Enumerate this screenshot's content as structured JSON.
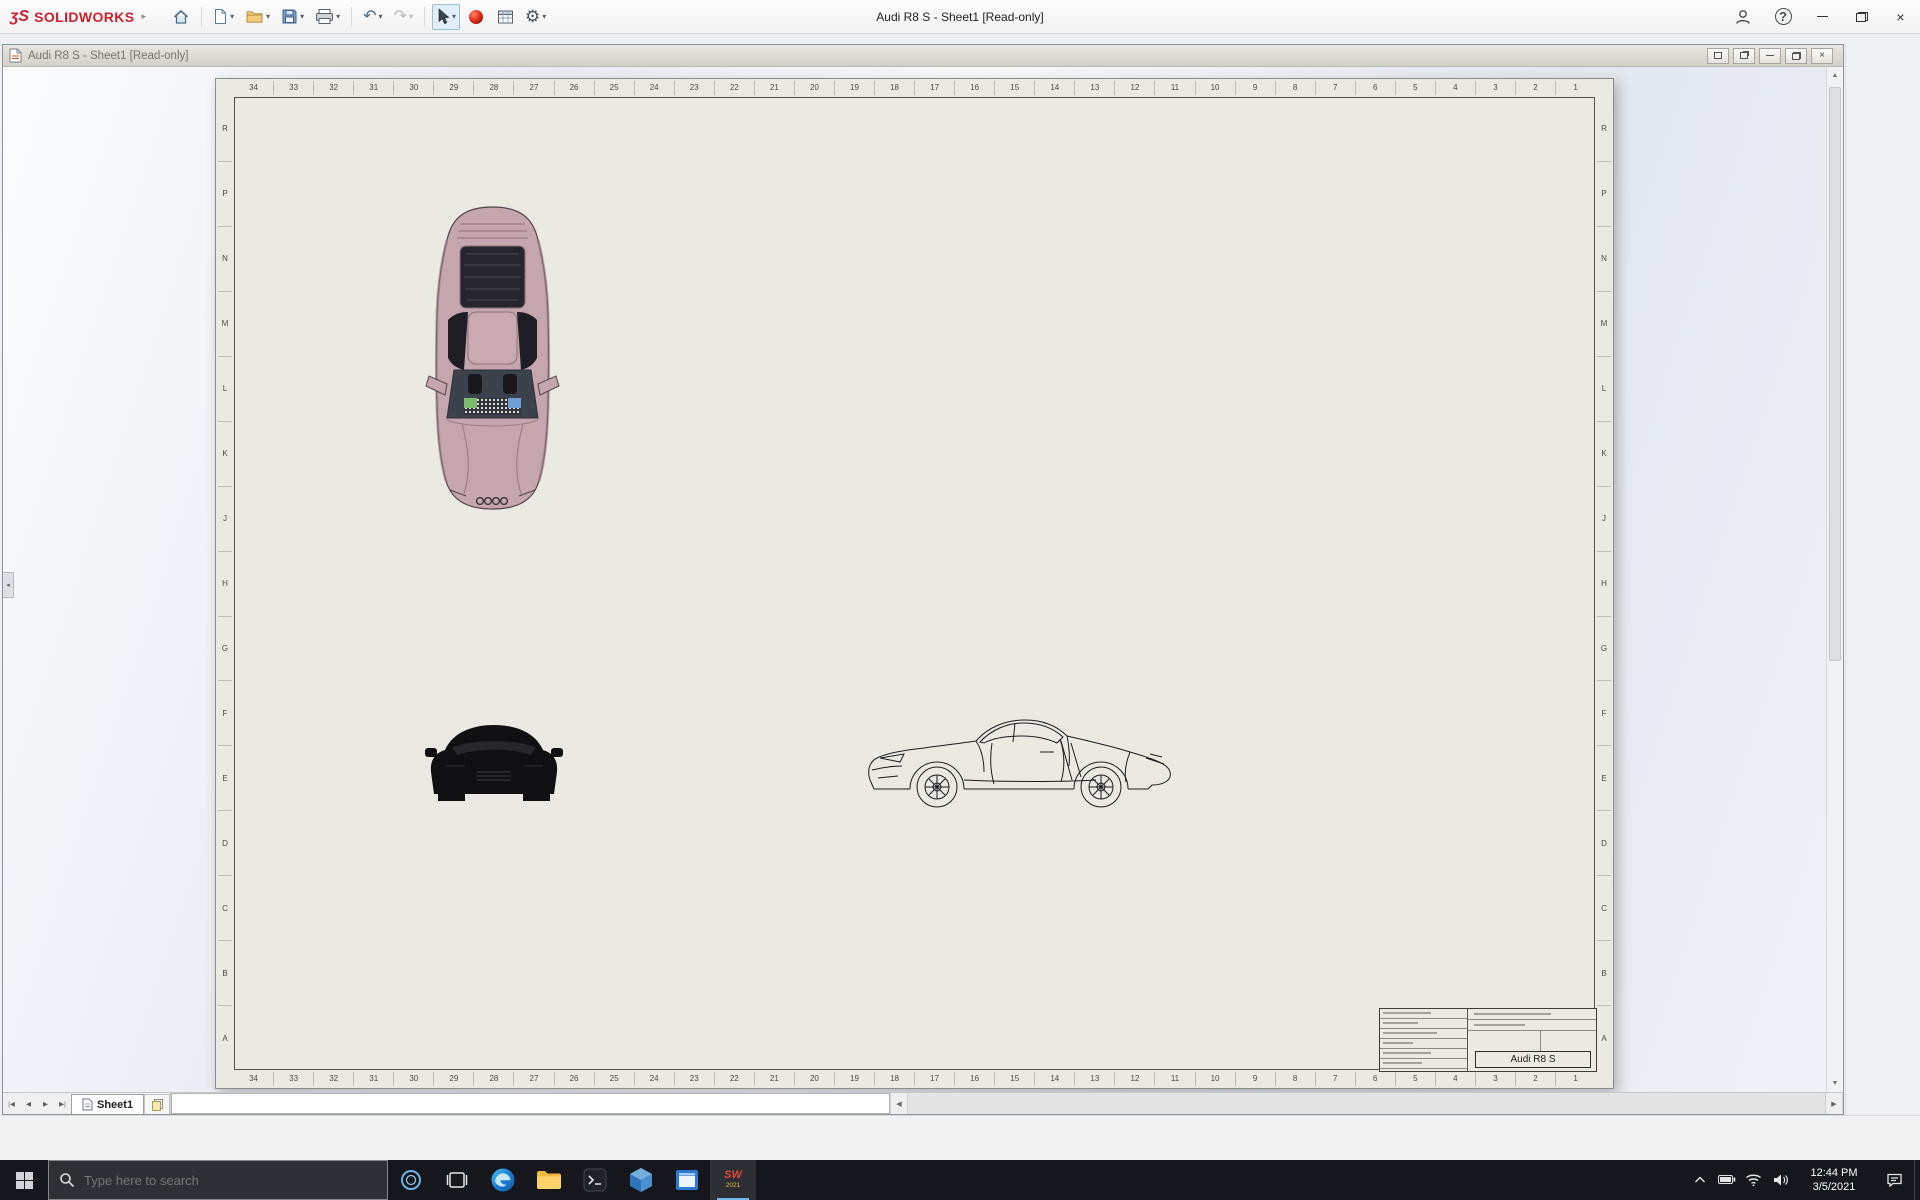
{
  "app": {
    "brand": "SOLIDWORKS",
    "window_title": "Audi R8 S - Sheet1 [Read-only]"
  },
  "doc": {
    "title": "Audi R8 S - Sheet1 [Read-only]",
    "sheet_tab": "Sheet1"
  },
  "drawing": {
    "title_block_model": "Audi R8 S",
    "zone_numbers": [
      "34",
      "33",
      "32",
      "31",
      "30",
      "29",
      "28",
      "27",
      "26",
      "25",
      "24",
      "23",
      "22",
      "21",
      "20",
      "19",
      "18",
      "17",
      "16",
      "15",
      "14",
      "13",
      "12",
      "11",
      "10",
      "9",
      "8",
      "7",
      "6",
      "5",
      "4",
      "3",
      "2",
      "1"
    ],
    "zone_letters": [
      "R",
      "P",
      "N",
      "M",
      "L",
      "K",
      "J",
      "H",
      "G",
      "F",
      "E",
      "D",
      "C",
      "B",
      "A"
    ]
  },
  "taskbar": {
    "search_placeholder": "Type here to search",
    "sw_badge": "SW",
    "solidworks_year_badge": "2021",
    "clock": {
      "time": "12:44 PM",
      "date": "3/5/2021"
    }
  },
  "colors": {
    "brand_red": "#cf1f2f",
    "sheet_paper": "#eaeae2",
    "taskbar_bg": "#15171d",
    "taskbar_accent": "#76b9ed"
  },
  "icons": {
    "logo_3ds": "ʒS",
    "brand_arrow": "▸",
    "undo": "↶",
    "redo": "↷",
    "gear": "⚙",
    "dropdown": "▾",
    "help": "?",
    "close": "×",
    "scroll_up": "▲",
    "scroll_down": "▼",
    "scroll_left": "◀",
    "scroll_right": "▶",
    "tab_first": "|◀",
    "tab_prev": "◀",
    "tab_next": "▶",
    "tab_last": "▶|",
    "flyout_left": "◂"
  }
}
